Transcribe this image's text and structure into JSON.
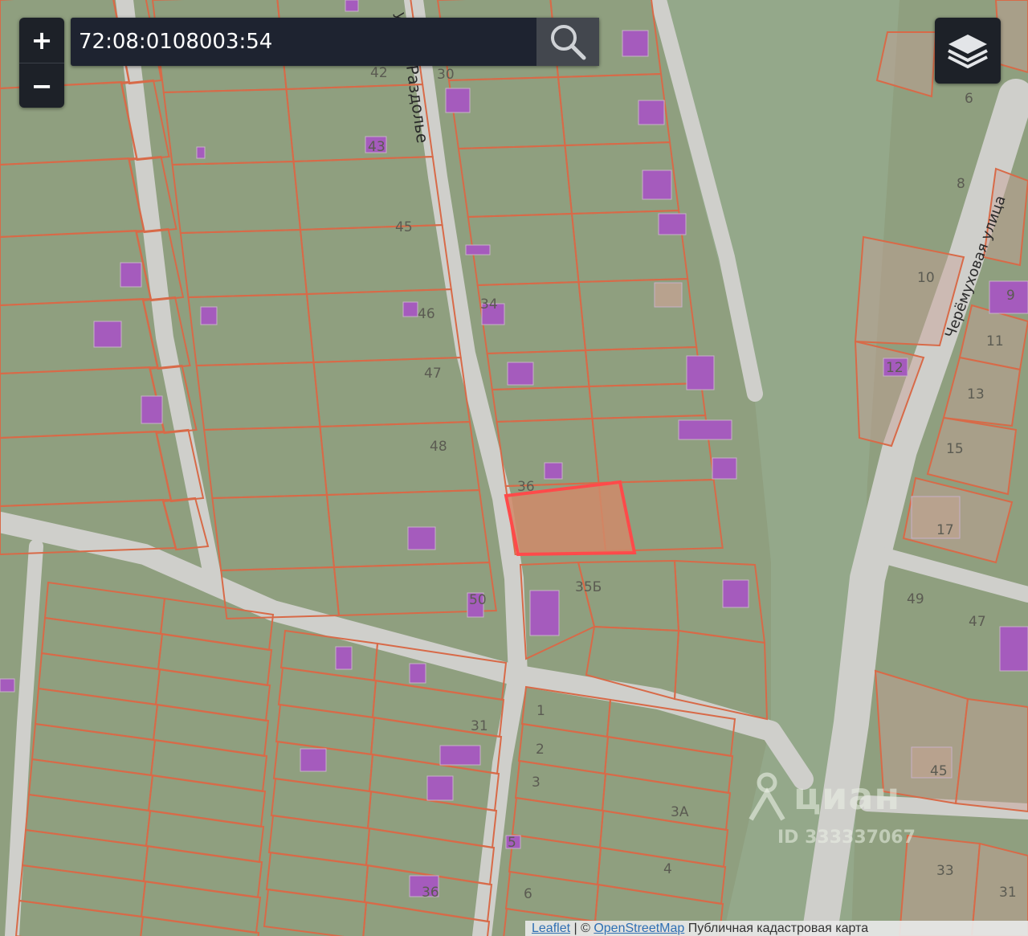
{
  "search": {
    "value": "72:08:0108003:54"
  },
  "zoom": {
    "in_label": "+",
    "out_label": "−"
  },
  "icons": {
    "search": "search-icon",
    "layers": "layers-icon",
    "watermark": "cian-logo-icon"
  },
  "attribution": {
    "leaflet": "Leaflet",
    "separator": " | © ",
    "osm": "OpenStreetMap",
    "cadastral": " Публичная кадастровая карта"
  },
  "watermark": {
    "brand": "циан",
    "listing_id": "ID 333337067"
  },
  "streets": {
    "razdolye": "Раздолье",
    "razdolye_prefix": "ул.",
    "cheremukhovaya": "Черёмуховая улица"
  },
  "parcel_numbers": {
    "n30": "30",
    "n42": "42",
    "n43": "43",
    "n45": "45",
    "n46": "46",
    "n47": "47",
    "n48": "48",
    "n34": "34",
    "n36": "36",
    "n35b": "35Б",
    "n50": "50",
    "n1": "1",
    "n2": "2",
    "n3": "3",
    "n3a": "3А",
    "n4": "4",
    "n5": "5",
    "n6b": "6",
    "n31": "31",
    "n36b": "36",
    "e6": "6",
    "e8": "8",
    "e9": "9",
    "e10": "10",
    "e11": "11",
    "e12": "12",
    "e13": "13",
    "e15": "15",
    "e17": "17",
    "e49": "49",
    "e47": "47",
    "e45": "45",
    "e33": "33",
    "e31": "31"
  },
  "colors": {
    "land": "#8f9f7f",
    "road": "#cfcfcb",
    "boundary": "#d86a48",
    "building": "#a55bbd",
    "selected": "#ff4a4a",
    "selected_fill": "#d08a6a"
  }
}
